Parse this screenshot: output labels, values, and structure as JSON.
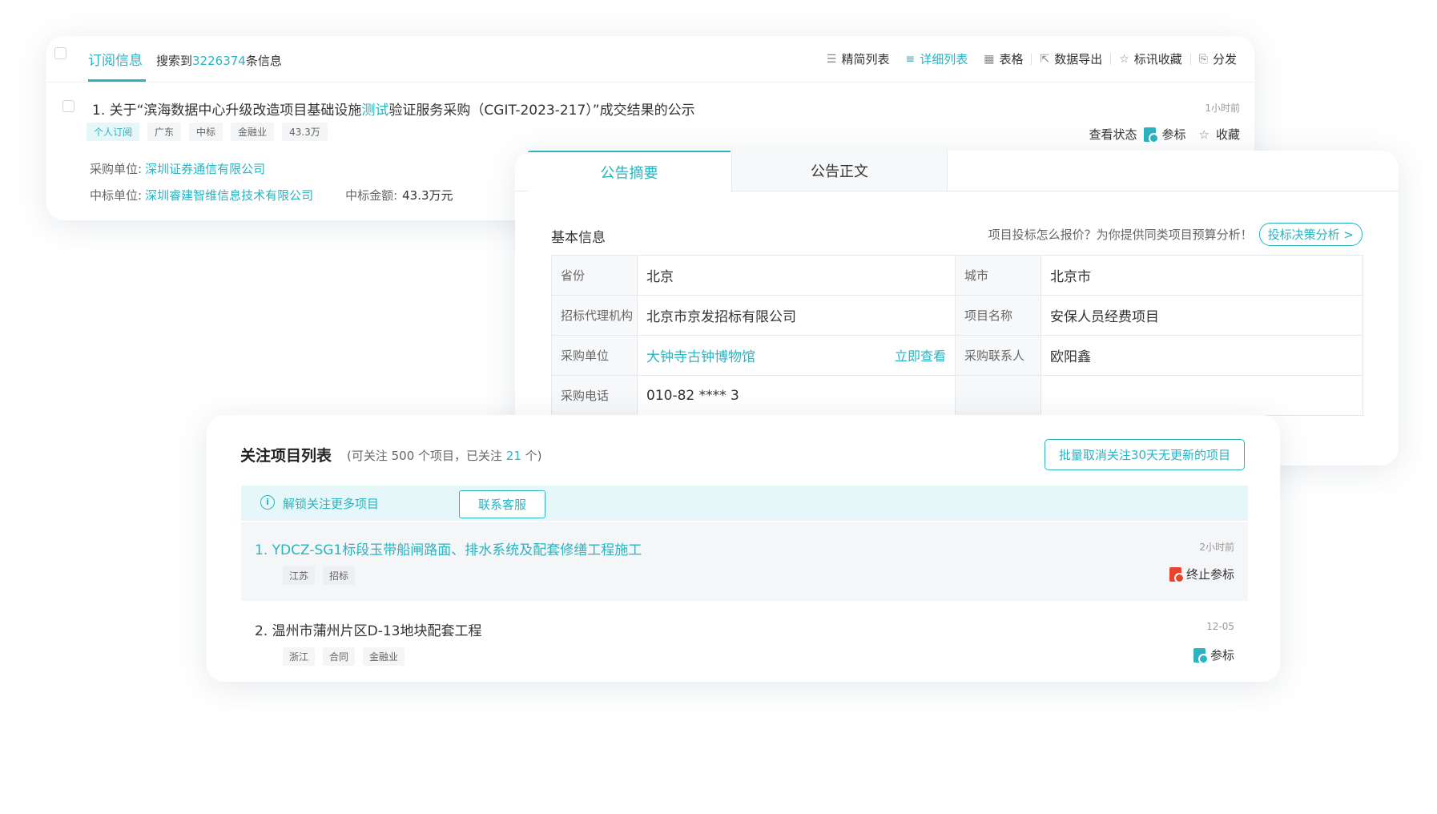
{
  "subscription": {
    "tab_label": "订阅信息",
    "search_prefix": "搜索到",
    "search_count": "3226374",
    "search_suffix": "条信息",
    "toolbar": {
      "simple_list": "精简列表",
      "detail_list": "详细列表",
      "table": "表格",
      "export": "数据导出",
      "bookmark": "标讯收藏",
      "share": "分发"
    },
    "item": {
      "title_prefix": "1. 关于“滨海数据中心升级改造项目基础设施",
      "title_highlight": "测试",
      "title_suffix": "验证服务采购（CGIT-2023-217）”成交结果的公示",
      "time": "1小时前",
      "tags": [
        "个人订阅",
        "广东",
        "中标",
        "金融业",
        "43.3万"
      ],
      "actions": {
        "view_status": "查看状态",
        "bid": "参标",
        "favorite": "收藏"
      },
      "purchaser_label": "采购单位:",
      "purchaser": "深圳证券通信有限公司",
      "winner_label": "中标单位:",
      "winner": "深圳睿建智维信息技术有限公司",
      "amount_label": "中标金额:",
      "amount": "43.3万元"
    }
  },
  "announcement": {
    "tabs": [
      "公告摘要",
      "公告正文"
    ],
    "section_title": "基本信息",
    "hint": "项目投标怎么报价？为你提供同类项目预算分析！",
    "analysis_button": "投标决策分析 >",
    "fields": {
      "province_label": "省份",
      "province": "北京",
      "city_label": "城市",
      "city": "北京市",
      "agency_label": "招标代理机构",
      "agency": "北京市京发招标有限公司",
      "project_label": "项目名称",
      "project": "安保人员经费项目",
      "purchaser_label": "采购单位",
      "purchaser": "大钟寺古钟博物馆",
      "view_now": "立即查看",
      "contact_label": "采购联系人",
      "contact": "欧阳鑫",
      "phone_label": "采购电话",
      "phone": "010-82 **** 3"
    }
  },
  "followed": {
    "title": "关注项目列表",
    "sub_prefix": "(可关注 500 个项目，已关注 ",
    "sub_count": "21",
    "sub_suffix": " 个)",
    "batch_button": "批量取消关注30天无更新的项目",
    "unlock_text": "解锁关注更多项目",
    "contact_button": "联系客服",
    "items": [
      {
        "title": "1. YDCZ-SG1标段玉带船闸路面、排水系统及配套修缮工程施工",
        "time": "2小时前",
        "tags": [
          "江苏",
          "招标"
        ],
        "action": "终止参标"
      },
      {
        "title": "2. 温州市蒲州片区D-13地块配套工程",
        "time": "12-05",
        "tags": [
          "浙江",
          "合同",
          "金融业"
        ],
        "action": "参标"
      }
    ]
  },
  "colors": {
    "accent": "#2bb3c0",
    "danger": "#e8452c",
    "bid_icon": "#2bb3c0"
  }
}
